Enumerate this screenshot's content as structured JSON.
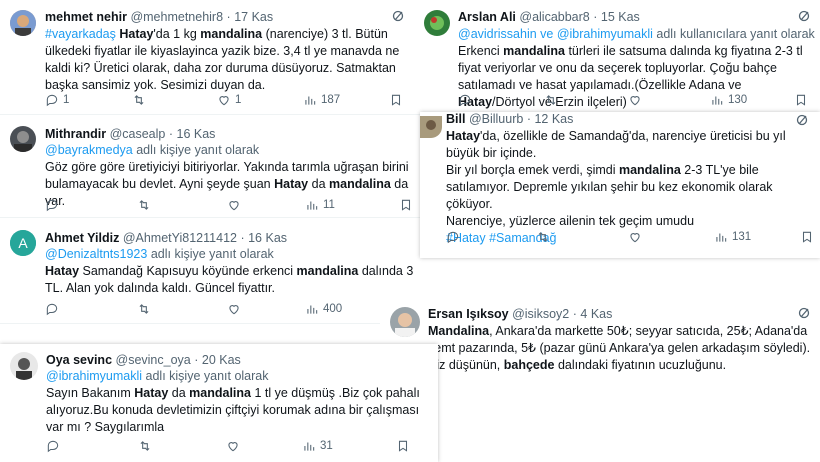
{
  "tweets": [
    {
      "name": "mehmet nehir",
      "handle": "@mehmetnehir8",
      "time": "17 Kas",
      "body": [
        "#vayarkadaş",
        " ",
        "Hatay",
        "'da 1 kg ",
        "mandalina",
        " (narenciye) 3 tl. Bütün ülkedeki fiyatlar ile kiyaslayinca yazik bize. 3,4 tl ye manavda ne kaldi ki? Üretici olarak, daha zor duruma düsüyoruz. Satmaktan başka sansimiz yok. Sesimizi duyan da."
      ],
      "replies": "1",
      "retweets": "",
      "likes": "1",
      "views": "187"
    },
    {
      "name": "Arslan Ali",
      "handle": "@alicabbar8",
      "time": "15 Kas",
      "replying_prefix": "",
      "replying_mentions": "@avidrissahin ve @ibrahimyumakli",
      "replying_suffix": " adlı kullanıcılara yanıt olarak",
      "body": [
        "Erkenci ",
        "mandalina",
        " türleri ile satsuma dalında kg fiyatına 2-3 tl fiyat veriyorlar ve onu da seçerek topluyorlar. Çoğu bahçe satılamadı ve hasat yapılamadı.(Özellikle Adana ve ",
        "Hatay",
        "/Dörtyol ve Erzin ilçeleri)"
      ],
      "views": "130"
    },
    {
      "name": "Mithrandir",
      "handle": "@casealp",
      "time": "16 Kas",
      "replying_mention": "@bayrakmedya",
      "replying_suffix": " adlı kişiye yanıt olarak",
      "body": [
        "Göz göre göre üretiyiciyi bitiriyorlar. Yakında tarımla uğraşan birini bulamayacak bu devlet. Ayni şeyde şuan ",
        "Hatay",
        " da ",
        "mandalina",
        " da var."
      ],
      "views": "11"
    },
    {
      "name": "Bill",
      "handle": "@Billuurb",
      "time": "12 Kas",
      "body_lines": [
        [
          "Hatay",
          "'da, özellikle de Samandağ'da, narenciye üreticisi bu yıl büyük bir içinde."
        ],
        [
          "",
          "Bir yıl borçla emek verdi, şimdi ",
          "mandalina",
          " 2-3 TL'ye bile satılamıyor. Depremle yıkılan şehir bu kez ekonomik olarak çöküyor."
        ],
        [
          "",
          "Narenciye, yüzlerce ailenin tek geçim umudu"
        ]
      ],
      "hashtags": "#Hatay #Samandağ",
      "views": "131"
    },
    {
      "name": "Ahmet Yildiz",
      "handle": "@AhmetYi81211412",
      "time": "16 Kas",
      "replying_mention": "@Denizaltnts1923",
      "replying_suffix": " adlı kişiye yanıt olarak",
      "body": [
        "Hatay",
        " Samandağ Kapısuyu köyünde erkenci ",
        "mandalina",
        " dalında 3 TL. Alan yok dalında kaldı. Güncel fiyattır."
      ],
      "views": "400"
    },
    {
      "name": "Ersan Işıksoy",
      "handle": "@isiksoy2",
      "time": "4 Kas",
      "body": [
        "Mandalina",
        ", Ankara'da markette 50₺; seyyar satıcıda, 25₺; Adana'da semt pazarında, 5₺ (pazar günü Ankara'ya gelen arkadaşım söyledi). Siz düşünün, ",
        "bahçede",
        " dalındaki fiyatının ucuzluğunu."
      ]
    },
    {
      "name": "Oya sevinc",
      "handle": "@sevinc_oya",
      "time": "20 Kas",
      "replying_mention": "@ibrahimyumakli",
      "replying_suffix": " adlı kişiye yanıt olarak",
      "body": [
        "Sayın Bakanım ",
        "Hatay",
        " da ",
        "mandalina",
        " 1 tl ye düşmüş .Biz çok pahalı alıyoruz.Bu konuda devletimizin çiftçiyi korumak adına bir çalışması var mı ? Saygılarımla"
      ],
      "views": "31"
    }
  ],
  "colors": {
    "accent": "#1d9bf0",
    "secondary": "#536471",
    "text": "#0f1419"
  },
  "icons": [
    "reply-icon",
    "retweet-icon",
    "like-icon",
    "views-icon",
    "bookmark-icon",
    "grok-icon"
  ]
}
